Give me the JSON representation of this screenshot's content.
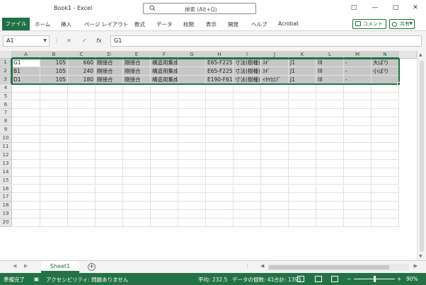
{
  "window": {
    "title": "Book1  -  Excel",
    "search_placeholder": "検索 (Alt+Q)",
    "controls": [
      "□",
      "—",
      "□",
      "✕"
    ]
  },
  "ribbon": {
    "file_tab": "ファイル",
    "tabs": [
      "ホーム",
      "挿入",
      "ページ レイアウト",
      "数式",
      "データ",
      "校閲",
      "表示",
      "開発",
      "ヘルプ",
      "Acrobat"
    ],
    "comment_label": "コメント",
    "share_label": "共有"
  },
  "formula_bar": {
    "name_box": "A1",
    "cancel_glyph": "✕",
    "enter_glyph": "✓",
    "fx_glyph": "fx",
    "formula": "G1"
  },
  "sheet": {
    "columns": [
      "A",
      "B",
      "C",
      "D",
      "E",
      "F",
      "G",
      "H",
      "I",
      "J",
      "K",
      "L",
      "M",
      "N"
    ],
    "row_count": 20,
    "rows": [
      [
        "G1",
        "105",
        "660",
        "剛接合",
        "剛接合",
        "構造用集成材(対称",
        "",
        "E65-F225",
        "寸法(樹種)",
        "ｽｷﾞ",
        "J1",
        "III",
        "-",
        "大ばり"
      ],
      [
        "B1",
        "105",
        "240",
        "剛接合",
        "剛接合",
        "構造用集成材(対称",
        "",
        "E65-F225",
        "寸法(樹種)",
        "ｽｷﾞ",
        "J1",
        "III",
        "-",
        "小ばり"
      ],
      [
        "D1",
        "105",
        "180",
        "剛接合",
        "剛接合",
        "構造用集成材(同一等",
        "",
        "E190-F615",
        "寸法(樹種)",
        "ｲﾀﾔｶｴﾃﾞ",
        "J1",
        "III",
        "-",
        ""
      ]
    ],
    "sheet_tab": "Sheet1",
    "add_sheet_glyph": "+"
  },
  "status": {
    "ready": "準備完了",
    "accessibility": "アクセシビリティ: 問題ありません",
    "average": "平均: 232.5",
    "count": "データの個数: 41",
    "sum": "合計: 1395",
    "zoom_minus": "−",
    "zoom_plus": "+",
    "zoom": "90%"
  },
  "colors": {
    "excel_green": "#217346",
    "selection_fill": "#c6c6c6"
  }
}
